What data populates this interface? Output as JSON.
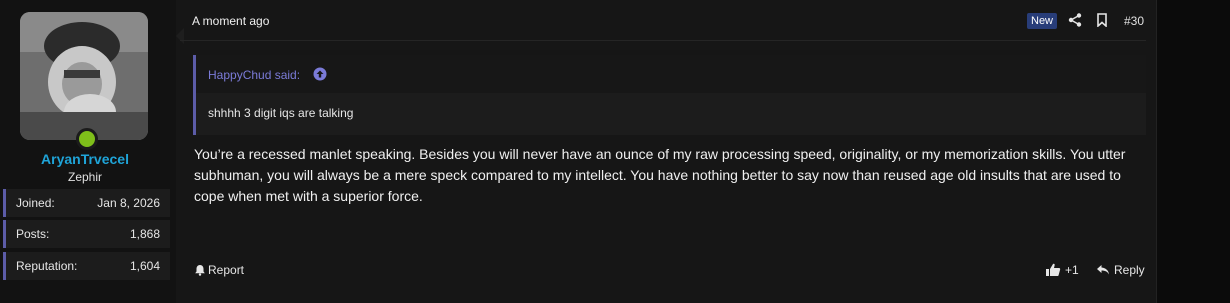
{
  "user": {
    "username": "AryanTrvecel",
    "title": "Zephir",
    "stats": [
      {
        "label": "Joined:",
        "value": "Jan 8, 2026"
      },
      {
        "label": "Posts:",
        "value": "1,868"
      },
      {
        "label": "Reputation:",
        "value": "1,604"
      }
    ],
    "online": true
  },
  "post": {
    "timestamp": "A moment ago",
    "badge": "New",
    "number": "#30",
    "quote": {
      "author": "HappyChud said:",
      "text": "shhhh 3 digit iqs are talking"
    },
    "body": "You’re a recessed manlet speaking. Besides you will never have an ounce of my raw processing speed, originality, or my memorization skills. You utter subhuman, you will always be a mere speck compared to my intellect. You have nothing better to say now than reused age old insults that are used to cope when met with a superior force.",
    "actions": {
      "report": "Report",
      "like_count": "+1",
      "reply": "Reply"
    }
  },
  "colors": {
    "username": "#1fa4d8",
    "accent": "#5c5ca8",
    "quote_author": "#7b7bd8",
    "badge_bg": "#283d79",
    "online": "#7fbf1a"
  },
  "icons": [
    "share-icon",
    "bookmark-icon",
    "up-arrow-icon",
    "bell-icon",
    "thumbs-up-icon",
    "reply-icon"
  ]
}
